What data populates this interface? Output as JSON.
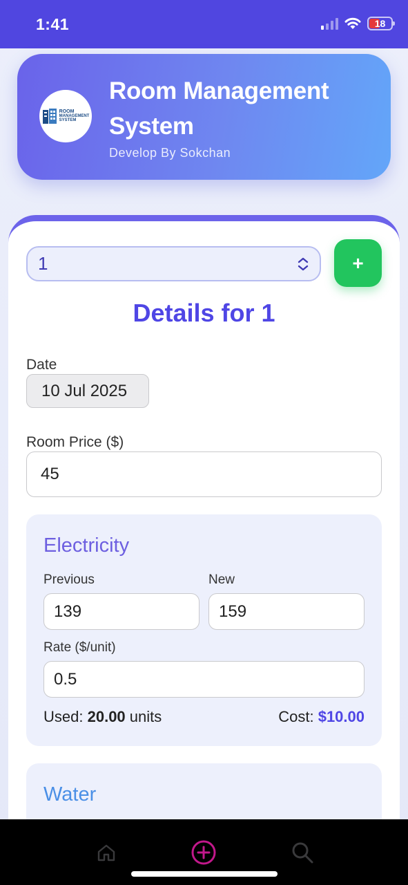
{
  "status_bar": {
    "time": "1:41",
    "battery": "18"
  },
  "header": {
    "title": "Room Management System",
    "subtitle": "Develop By Sokchan",
    "logo_text": [
      "ROOM",
      "MANAGEMENT",
      "SYSTEM"
    ]
  },
  "room_selector": {
    "selected": "1",
    "add_label": "+"
  },
  "details": {
    "title": "Details for 1",
    "date_label": "Date",
    "date_value": "10 Jul 2025",
    "price_label": "Room Price ($)",
    "price_value": "45"
  },
  "electricity": {
    "title": "Electricity",
    "previous_label": "Previous",
    "previous_value": "139",
    "new_label": "New",
    "new_value": "159",
    "rate_label": "Rate ($/unit)",
    "rate_value": "0.5",
    "used_label": "Used:",
    "used_value": "20.00",
    "used_unit": "units",
    "cost_label": "Cost:",
    "cost_value": "$10.00"
  },
  "water": {
    "title": "Water"
  },
  "nav": {
    "items": [
      "home-icon",
      "add-circle-icon",
      "search-icon"
    ],
    "active_color": "#c2188b"
  },
  "colors": {
    "accent": "#4f46e5",
    "add_button": "#22c55e"
  }
}
